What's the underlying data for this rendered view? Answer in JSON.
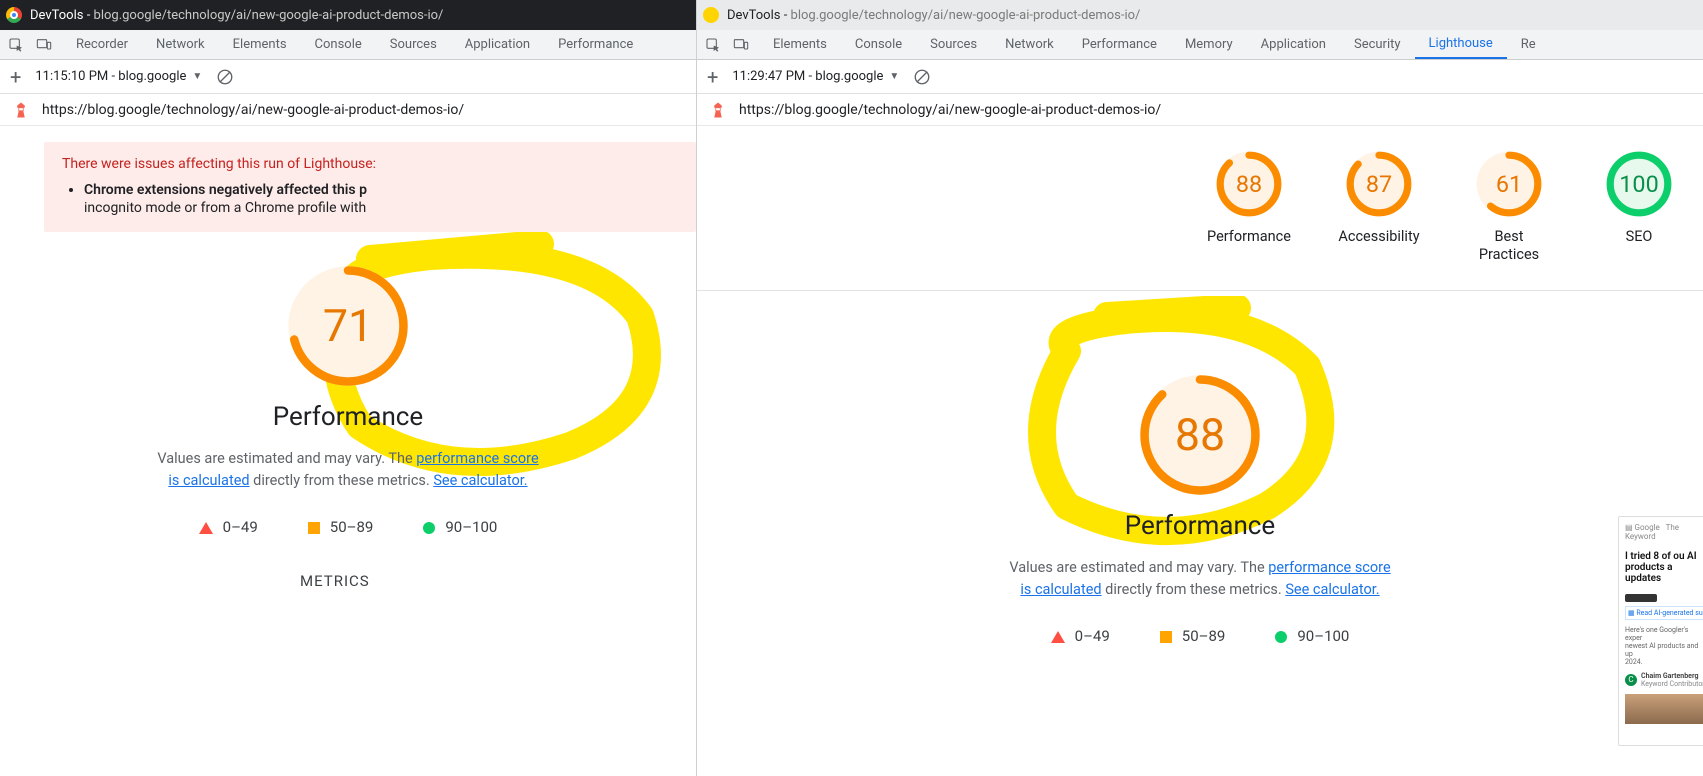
{
  "left": {
    "title_prefix": "DevTools - ",
    "title_url": "blog.google/technology/ai/new-google-ai-product-demos-io/",
    "tabs": [
      "Recorder",
      "Network",
      "Elements",
      "Console",
      "Sources",
      "Application",
      "Performance"
    ],
    "report_time": "11:15:10 PM - blog.google",
    "url": "https://blog.google/technology/ai/new-google-ai-product-demos-io/",
    "warning_head": "There were issues affecting this run of Lighthouse:",
    "warning_bold": "Chrome extensions negatively affected this p",
    "warning_rest": "incognito mode or from a Chrome profile with",
    "score": 71,
    "perf_label": "Performance",
    "note_a": "Values are estimated and may vary. The ",
    "link1": "performance score",
    "link2": "is calculated",
    "note_b": " directly from these metrics. ",
    "link3": "See calculator.",
    "legend": [
      "0–49",
      "50–89",
      "90–100"
    ],
    "metrics": "METRICS"
  },
  "right": {
    "title_prefix": "DevTools - ",
    "title_url": "blog.google/technology/ai/new-google-ai-product-demos-io/",
    "tabs": [
      "Elements",
      "Console",
      "Sources",
      "Network",
      "Performance",
      "Memory",
      "Application",
      "Security",
      "Lighthouse",
      "Re"
    ],
    "active_tab": "Lighthouse",
    "report_time": "11:29:47 PM - blog.google",
    "url": "https://blog.google/technology/ai/new-google-ai-product-demos-io/",
    "gauges": [
      {
        "score": 88,
        "label": "Performance",
        "cls": "orange"
      },
      {
        "score": 87,
        "label": "Accessibility",
        "cls": "orange"
      },
      {
        "score": 61,
        "label": "Best Practices",
        "cls": "orange"
      },
      {
        "score": 100,
        "label": "SEO",
        "cls": "green"
      }
    ],
    "score": 88,
    "perf_label": "Performance",
    "note_a": "Values are estimated and may vary. The ",
    "link1": "performance score",
    "link2": "is calculated",
    "note_b": " directly from these metrics. ",
    "link3": "See calculator.",
    "legend": [
      "0–49",
      "50–89",
      "90–100"
    ],
    "preview_head": "I tried 8 of ou AI products a updates"
  },
  "chart_data": [
    {
      "type": "gauge",
      "title": "Performance (left run)",
      "value": 71,
      "range": [
        0,
        100
      ],
      "band": "50–89"
    },
    {
      "type": "gauge",
      "title": "Performance",
      "value": 88,
      "range": [
        0,
        100
      ],
      "band": "50–89"
    },
    {
      "type": "gauge",
      "title": "Accessibility",
      "value": 87,
      "range": [
        0,
        100
      ],
      "band": "50–89"
    },
    {
      "type": "gauge",
      "title": "Best Practices",
      "value": 61,
      "range": [
        0,
        100
      ],
      "band": "50–89"
    },
    {
      "type": "gauge",
      "title": "SEO",
      "value": 100,
      "range": [
        0,
        100
      ],
      "band": "90–100"
    },
    {
      "type": "gauge",
      "title": "Performance (right big)",
      "value": 88,
      "range": [
        0,
        100
      ],
      "band": "50–89"
    }
  ]
}
